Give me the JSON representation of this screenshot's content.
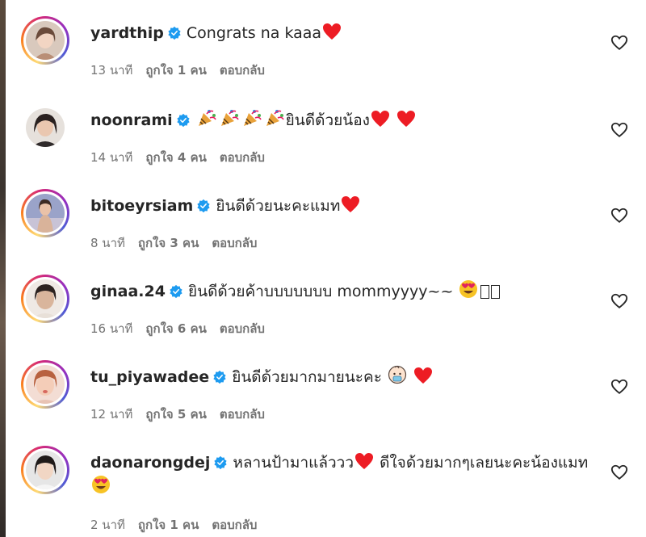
{
  "comments": [
    {
      "username": "yardthip",
      "text_before": "Congrats na kaaa",
      "emojis_after": [
        "red-heart"
      ],
      "text_after": "",
      "time": "13 นาที",
      "likes": "ถูกใจ 1 คน",
      "reply": "ตอบกลับ",
      "story_ring": true
    },
    {
      "username": "noonrami",
      "text_before": "",
      "emojis_before": [
        "party-popper",
        "party-popper",
        "party-popper",
        "party-popper"
      ],
      "text_after": "ยินดีด้วยน้อง",
      "emojis_after": [
        "red-heart",
        "red-heart"
      ],
      "time": "14 นาที",
      "likes": "ถูกใจ 4 คน",
      "reply": "ตอบกลับ",
      "story_ring": false
    },
    {
      "username": "bitoeyrsiam",
      "text_before": "ยินดีด้วยนะคะแมท",
      "emojis_after": [
        "red-heart"
      ],
      "time": "8 นาที",
      "likes": "ถูกใจ 3 คน",
      "reply": "ตอบกลับ",
      "story_ring": true
    },
    {
      "username": "ginaa.24",
      "text_before": "ยินดีด้วยค้าบบบบบบบ mommyyyy~~ ",
      "emojis_after": [
        "heart-eyes-face"
      ],
      "missing_glyphs": 2,
      "time": "16 นาที",
      "likes": "ถูกใจ 6 คน",
      "reply": "ตอบกลับ",
      "story_ring": true
    },
    {
      "username": "tu_piyawadee",
      "text_before": "ยินดีด้วยมากมายนะคะ ",
      "emojis_after": [
        "baby-face",
        "red-heart"
      ],
      "time": "12 นาที",
      "likes": "ถูกใจ 5 คน",
      "reply": "ตอบกลับ",
      "story_ring": true
    },
    {
      "username": "daonarongdej",
      "text_before": "หลานป้ามาแล้ววว",
      "text_mid": " ดีใจด้วยมากๆเลยนะคะน้องแมท",
      "emojis_mid": [
        "red-heart"
      ],
      "emojis_end": [
        "heart-eyes-face"
      ],
      "time": "2 นาที",
      "likes": "ถูกใจ 1 คน",
      "reply": "ตอบกลับ",
      "story_ring": true
    }
  ],
  "icons": {
    "verified": "verified-badge-icon",
    "like": "heart-outline-icon"
  },
  "colors": {
    "verified": "#1d9bf0",
    "heart": "#ed1c24",
    "meta": "#737373",
    "text": "#262626"
  }
}
